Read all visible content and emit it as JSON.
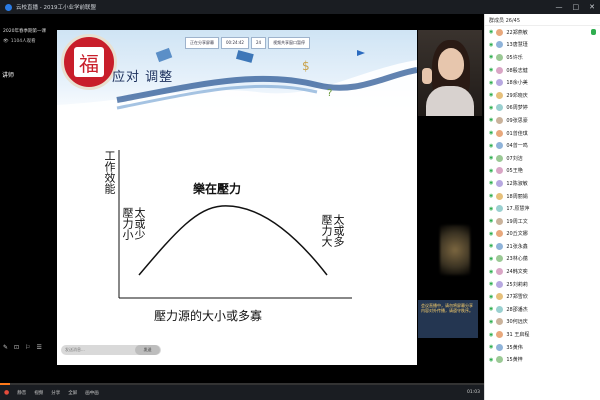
{
  "topbar": {
    "title": "云校直播 - 2019工小业学前联盟",
    "minimize": "—",
    "maximize": "□",
    "close": "✕"
  },
  "left_panel": {
    "title": "2020年春季期第一课",
    "viewers": "1104人观看",
    "tag": "讲师",
    "tools": [
      "✎",
      "⊡",
      "⚐",
      "☰"
    ]
  },
  "toolbar_pills": [
    "正在分享屏幕",
    "00:24:42",
    "24",
    "视频共享窗口暂停"
  ],
  "close_label": "结束",
  "slide": {
    "title": "应对 调整",
    "seal_char": "福",
    "ylabel": "工作效能",
    "peak_label": "樂在壓力",
    "left_note_col1": "太或少",
    "left_note_col2": "壓力小",
    "right_note_col1": "太或多",
    "right_note_col2": "壓力大",
    "xlabel": "壓力源的大小或多寡"
  },
  "chat": {
    "placeholder": "发送消息...",
    "send": "发送"
  },
  "notify": {
    "text": "会议直播中，请勿将屏幕分享内容对外传播，请遵守秩序。"
  },
  "bottombar": {
    "mic": "●",
    "items": [
      "静音",
      "视频",
      "分享",
      "全屏",
      "画中画"
    ],
    "time": "01:03"
  },
  "progress_fraction": 0.02,
  "right_panel": {
    "header": "群成员 26/45",
    "members": [
      "22郑燕敏",
      "13唐慧瑾",
      "05许乐",
      "08殷志健",
      "18余小美",
      "29邓晓庆",
      "06周梦婷",
      "09张思豪",
      "01曾佳琪",
      "04曾一鸣",
      "07刘洁",
      "05王艳",
      "12陈淑敏",
      "18周丽娟",
      "17.原慧萍",
      "19周工文",
      "20丘文娜",
      "21张永鑫",
      "23林心蕴",
      "24韩文奕",
      "25刘莉莉",
      "27郑雪欣",
      "28邵潘杰",
      "30何远庆",
      "31 王启程",
      "35黄伟",
      "15黄梓"
    ],
    "online_flag": "◉",
    "speaker_index": 0
  }
}
